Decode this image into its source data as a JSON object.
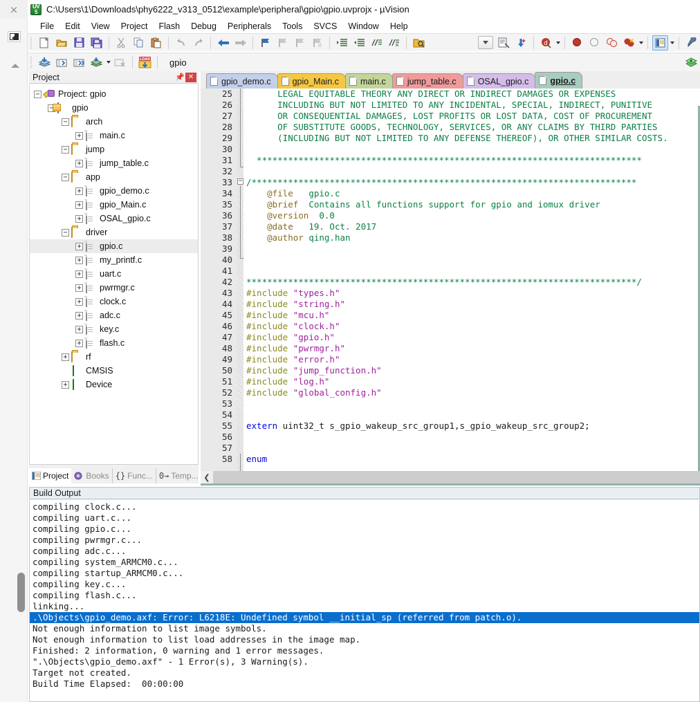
{
  "window": {
    "title": "C:\\Users\\1\\Downloads\\phy6222_v313_0512\\example\\peripheral\\gpio\\gpio.uvprojx - µVision",
    "app_icon": "uvision-icon",
    "close_label": "×"
  },
  "menu": {
    "items": [
      {
        "label": "File"
      },
      {
        "label": "Edit"
      },
      {
        "label": "View"
      },
      {
        "label": "Project"
      },
      {
        "label": "Flash"
      },
      {
        "label": "Debug"
      },
      {
        "label": "Peripherals"
      },
      {
        "label": "Tools"
      },
      {
        "label": "SVCS"
      },
      {
        "label": "Window"
      },
      {
        "label": "Help"
      }
    ]
  },
  "toolbar": {
    "target_value": "gpio",
    "row1_icons": [
      "new-file-icon",
      "open-file-icon",
      "save-icon",
      "save-all-icon",
      "cut-icon",
      "copy-icon",
      "paste-icon",
      "undo-icon",
      "redo-icon",
      "navigate-back-icon",
      "navigate-forward-icon",
      "bookmark-toggle-icon",
      "bookmark-prev-icon",
      "bookmark-next-icon",
      "bookmark-clear-icon",
      "indent-icon",
      "outdent-icon",
      "comment-icon",
      "uncomment-icon",
      "open-folder-icon"
    ],
    "row2_icons": [
      "build-icon",
      "translate-icon",
      "rebuild-icon",
      "batch-build-icon",
      "batch-build-arrow",
      "stop-build-icon",
      "load-icon"
    ],
    "row2_right_icons": [
      "combo-dropdown",
      "target-options-icon",
      "configure-wizard-icon",
      "debug-session-icon",
      "debug-arrow",
      "insert-breakpoint-icon",
      "enable-breakpoint-icon",
      "disable-all-breakpoints-icon",
      "kill-all-breakpoints-icon",
      "kill-arrow",
      "manage-windows-icon",
      "manage-arrow",
      "configure-icon",
      "pack-installer-icon"
    ]
  },
  "project_pane": {
    "title": "Project",
    "pin_icon": "pin-icon",
    "close_icon": "close-icon",
    "tree": [
      {
        "label": "Project: gpio",
        "depth": 0,
        "icon": "project-icon",
        "expander": "-",
        "selected": false
      },
      {
        "label": "gpio",
        "depth": 1,
        "icon": "target-icon",
        "expander": "-",
        "selected": false
      },
      {
        "label": "arch",
        "depth": 2,
        "icon": "folder-icon",
        "expander": "-",
        "selected": false
      },
      {
        "label": "main.c",
        "depth": 3,
        "icon": "c-file-icon",
        "expander": "+",
        "selected": false
      },
      {
        "label": "jump",
        "depth": 2,
        "icon": "folder-icon",
        "expander": "-",
        "selected": false
      },
      {
        "label": "jump_table.c",
        "depth": 3,
        "icon": "c-file-icon",
        "expander": "+",
        "selected": false
      },
      {
        "label": "app",
        "depth": 2,
        "icon": "folder-icon",
        "expander": "-",
        "selected": false
      },
      {
        "label": "gpio_demo.c",
        "depth": 3,
        "icon": "c-file-icon",
        "expander": "+",
        "selected": false
      },
      {
        "label": "gpio_Main.c",
        "depth": 3,
        "icon": "c-file-icon",
        "expander": "+",
        "selected": false
      },
      {
        "label": "OSAL_gpio.c",
        "depth": 3,
        "icon": "c-file-icon",
        "expander": "+",
        "selected": false
      },
      {
        "label": "driver",
        "depth": 2,
        "icon": "folder-icon",
        "expander": "-",
        "selected": false
      },
      {
        "label": "gpio.c",
        "depth": 3,
        "icon": "c-file-icon",
        "expander": "+",
        "selected": true
      },
      {
        "label": "my_printf.c",
        "depth": 3,
        "icon": "c-file-icon",
        "expander": "+",
        "selected": false
      },
      {
        "label": "uart.c",
        "depth": 3,
        "icon": "c-file-icon",
        "expander": "+",
        "selected": false
      },
      {
        "label": "pwrmgr.c",
        "depth": 3,
        "icon": "c-file-icon",
        "expander": "+",
        "selected": false
      },
      {
        "label": "clock.c",
        "depth": 3,
        "icon": "c-file-icon",
        "expander": "+",
        "selected": false
      },
      {
        "label": "adc.c",
        "depth": 3,
        "icon": "c-file-icon",
        "expander": "+",
        "selected": false
      },
      {
        "label": "key.c",
        "depth": 3,
        "icon": "c-file-icon",
        "expander": "+",
        "selected": false
      },
      {
        "label": "flash.c",
        "depth": 3,
        "icon": "c-file-icon",
        "expander": "+",
        "selected": false
      },
      {
        "label": "rf",
        "depth": 2,
        "icon": "folder-icon",
        "expander": "+",
        "selected": false
      },
      {
        "label": "CMSIS",
        "depth": 2,
        "icon": "gem-icon",
        "expander": "",
        "selected": false
      },
      {
        "label": "Device",
        "depth": 2,
        "icon": "gem-icon",
        "expander": "+",
        "selected": false
      }
    ],
    "tabs": [
      {
        "label": "Project",
        "icon": "project-tab-icon",
        "selected": true
      },
      {
        "label": "Books",
        "icon": "books-icon",
        "selected": false
      },
      {
        "label": "Func...",
        "icon": "braces-icon",
        "selected": false
      },
      {
        "label": "Temp...",
        "icon": "template-icon",
        "selected": false
      }
    ]
  },
  "editor": {
    "tabs": [
      {
        "label": "gpio_demo.c",
        "color": "#c3d0ea",
        "selected": false
      },
      {
        "label": "gpio_Main.c",
        "color": "#f6c842",
        "selected": false
      },
      {
        "label": "main.c",
        "color": "#c3d59a",
        "selected": false
      },
      {
        "label": "jump_table.c",
        "color": "#f09a9a",
        "selected": false
      },
      {
        "label": "OSAL_gpio.c",
        "color": "#d5bdea",
        "selected": false
      },
      {
        "label": "gpio.c",
        "color": "#a8cdbe",
        "selected": true
      }
    ],
    "first_line": 25,
    "lines": [
      {
        "n": 25,
        "segs": [
          {
            "t": "      LEGAL EQUITABLE THEORY ANY DIRECT OR INDIRECT DAMAGES OR EXPENSES",
            "c": "cm"
          }
        ]
      },
      {
        "n": 26,
        "segs": [
          {
            "t": "      INCLUDING BUT NOT LIMITED TO ANY INCIDENTAL, SPECIAL, INDIRECT, PUNITIVE",
            "c": "cm"
          }
        ]
      },
      {
        "n": 27,
        "segs": [
          {
            "t": "      OR CONSEQUENTIAL DAMAGES, LOST PROFITS OR LOST DATA, COST OF PROCUREMENT",
            "c": "cm"
          }
        ]
      },
      {
        "n": 28,
        "segs": [
          {
            "t": "      OF SUBSTITUTE GOODS, TECHNOLOGY, SERVICES, OR ANY CLAIMS BY THIRD PARTIES",
            "c": "cm"
          }
        ]
      },
      {
        "n": 29,
        "segs": [
          {
            "t": "      (INCLUDING BUT NOT LIMITED TO ANY DEFENSE THEREOF), OR OTHER SIMILAR COSTS.",
            "c": "cm"
          }
        ]
      },
      {
        "n": 30,
        "segs": []
      },
      {
        "n": 31,
        "segs": [
          {
            "t": "  **************************************************************************",
            "c": "cm"
          }
        ]
      },
      {
        "n": 32,
        "segs": []
      },
      {
        "n": 33,
        "segs": [
          {
            "t": "/**************************************************************************",
            "c": "cm"
          }
        ]
      },
      {
        "n": 34,
        "segs": [
          {
            "t": "    ",
            "c": "cm"
          },
          {
            "t": "@file",
            "c": "doc"
          },
          {
            "t": "   gpio.c",
            "c": "cm"
          }
        ]
      },
      {
        "n": 35,
        "segs": [
          {
            "t": "    ",
            "c": "cm"
          },
          {
            "t": "@brief",
            "c": "doc"
          },
          {
            "t": "  Contains all functions support for gpio and iomux driver",
            "c": "cm"
          }
        ]
      },
      {
        "n": 36,
        "segs": [
          {
            "t": "    ",
            "c": "cm"
          },
          {
            "t": "@version",
            "c": "doc"
          },
          {
            "t": "  0.0",
            "c": "cm"
          }
        ]
      },
      {
        "n": 37,
        "segs": [
          {
            "t": "    ",
            "c": "cm"
          },
          {
            "t": "@date",
            "c": "doc"
          },
          {
            "t": "   19. Oct. 2017",
            "c": "cm"
          }
        ]
      },
      {
        "n": 38,
        "segs": [
          {
            "t": "    ",
            "c": "cm"
          },
          {
            "t": "@author",
            "c": "doc"
          },
          {
            "t": " qing.han",
            "c": "cm"
          }
        ]
      },
      {
        "n": 39,
        "segs": []
      },
      {
        "n": 40,
        "segs": []
      },
      {
        "n": 41,
        "segs": []
      },
      {
        "n": 42,
        "segs": [
          {
            "t": "***************************************************************************/",
            "c": "cm"
          }
        ]
      },
      {
        "n": 43,
        "segs": [
          {
            "t": "#include",
            "c": "pp"
          },
          {
            "t": " ",
            "c": "pl"
          },
          {
            "t": "\"types.h\"",
            "c": "str"
          }
        ]
      },
      {
        "n": 44,
        "segs": [
          {
            "t": "#include",
            "c": "pp"
          },
          {
            "t": " ",
            "c": "pl"
          },
          {
            "t": "\"string.h\"",
            "c": "str"
          }
        ]
      },
      {
        "n": 45,
        "segs": [
          {
            "t": "#include",
            "c": "pp"
          },
          {
            "t": " ",
            "c": "pl"
          },
          {
            "t": "\"mcu.h\"",
            "c": "str"
          }
        ]
      },
      {
        "n": 46,
        "segs": [
          {
            "t": "#include",
            "c": "pp"
          },
          {
            "t": " ",
            "c": "pl"
          },
          {
            "t": "\"clock.h\"",
            "c": "str"
          }
        ]
      },
      {
        "n": 47,
        "segs": [
          {
            "t": "#include",
            "c": "pp"
          },
          {
            "t": " ",
            "c": "pl"
          },
          {
            "t": "\"gpio.h\"",
            "c": "str"
          }
        ]
      },
      {
        "n": 48,
        "segs": [
          {
            "t": "#include",
            "c": "pp"
          },
          {
            "t": " ",
            "c": "pl"
          },
          {
            "t": "\"pwrmgr.h\"",
            "c": "str"
          }
        ]
      },
      {
        "n": 49,
        "segs": [
          {
            "t": "#include",
            "c": "pp"
          },
          {
            "t": " ",
            "c": "pl"
          },
          {
            "t": "\"error.h\"",
            "c": "str"
          }
        ]
      },
      {
        "n": 50,
        "segs": [
          {
            "t": "#include",
            "c": "pp"
          },
          {
            "t": " ",
            "c": "pl"
          },
          {
            "t": "\"jump_function.h\"",
            "c": "str"
          }
        ]
      },
      {
        "n": 51,
        "segs": [
          {
            "t": "#include",
            "c": "pp"
          },
          {
            "t": " ",
            "c": "pl"
          },
          {
            "t": "\"log.h\"",
            "c": "str"
          }
        ]
      },
      {
        "n": 52,
        "segs": [
          {
            "t": "#include",
            "c": "pp"
          },
          {
            "t": " ",
            "c": "pl"
          },
          {
            "t": "\"global_config.h\"",
            "c": "str"
          }
        ]
      },
      {
        "n": 53,
        "segs": []
      },
      {
        "n": 54,
        "segs": []
      },
      {
        "n": 55,
        "segs": [
          {
            "t": "extern",
            "c": "kw"
          },
          {
            "t": " uint32_t s_gpio_wakeup_src_group1,s_gpio_wakeup_src_group2;",
            "c": "pl"
          }
        ]
      },
      {
        "n": 56,
        "segs": []
      },
      {
        "n": 57,
        "segs": []
      },
      {
        "n": 58,
        "segs": [
          {
            "t": "enum",
            "c": "kw"
          }
        ]
      }
    ]
  },
  "build_output": {
    "title": "Build Output",
    "lines": [
      {
        "text": "compiling clock.c...",
        "error": false
      },
      {
        "text": "compiling uart.c...",
        "error": false
      },
      {
        "text": "compiling gpio.c...",
        "error": false
      },
      {
        "text": "compiling pwrmgr.c...",
        "error": false
      },
      {
        "text": "compiling adc.c...",
        "error": false
      },
      {
        "text": "compiling system_ARMCM0.c...",
        "error": false
      },
      {
        "text": "compiling startup_ARMCM0.c...",
        "error": false
      },
      {
        "text": "compiling key.c...",
        "error": false
      },
      {
        "text": "compiling flash.c...",
        "error": false
      },
      {
        "text": "linking...",
        "error": false
      },
      {
        "text": ".\\Objects\\gpio_demo.axf: Error: L6218E: Undefined symbol __initial_sp (referred from patch.o).",
        "error": true
      },
      {
        "text": "Not enough information to list image symbols.",
        "error": false
      },
      {
        "text": "Not enough information to list load addresses in the image map.",
        "error": false
      },
      {
        "text": "Finished: 2 information, 0 warning and 1 error messages.",
        "error": false
      },
      {
        "text": "\".\\Objects\\gpio_demo.axf\" - 1 Error(s), 3 Warning(s).",
        "error": false
      },
      {
        "text": "Target not created.",
        "error": false
      },
      {
        "text": "Build Time Elapsed:  00:00:00",
        "error": false
      }
    ]
  },
  "colors": {
    "error_highlight": "#0a6ecd",
    "comment": "#0b8043",
    "keyword": "#0000ee",
    "string": "#a020a0",
    "preprocessor": "#8a8a22",
    "doc_tag": "#8a6d1f"
  }
}
